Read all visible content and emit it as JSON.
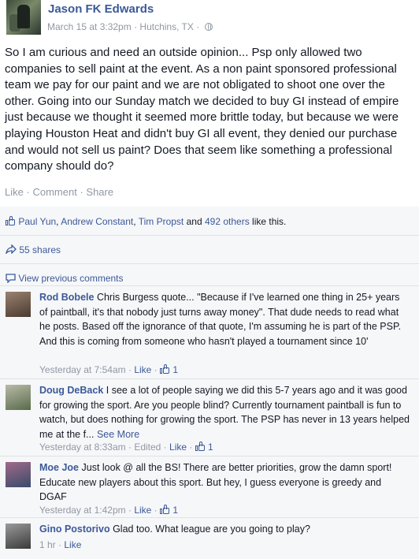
{
  "post": {
    "author": "Jason FK Edwards",
    "date": "March 15 at 3:32pm",
    "location": "Hutchins, TX",
    "separator": "·",
    "body": "So I am curious and need an outside opinion... Psp only allowed two companies to sell paint at the event. As a non paint sponsored professional team we pay for our paint and we are not obligated to shoot one over the other. Going into our Sunday match we decided to buy GI instead of empire just because we thought it seemed more brittle today, but because we were playing Houston Heat and didn't buy GI all event, they denied our purchase and would not sell us paint? Does that seem like something a professional company should do?",
    "actions": {
      "like": "Like",
      "comment": "Comment",
      "share": "Share"
    }
  },
  "likes_summary": {
    "names": [
      "Paul Yun",
      "Andrew Constant",
      "Tim Propst"
    ],
    "and": "and",
    "others": "492 others",
    "suffix": "like this."
  },
  "shares": "55 shares",
  "view_previous": "View previous comments",
  "comments": [
    {
      "name": "Rod Bobele",
      "text": "Chris Burgess quote... \"Because if I've learned one thing in 25+ years of paintball, it's that nobody just turns away money\". That dude needs to read what he posts. Based off the ignorance of that quote, I'm assuming he is part of the PSP. And this is coming from someone who hasn't played a tournament since 10'",
      "time": "Yesterday at 7:54am",
      "like": "Like",
      "likes": "1",
      "avatar_color": "#6b5a4a"
    },
    {
      "name": "Doug DeBack",
      "text": "I see a lot of people saying we did this 5-7 years ago and it was good for growing the sport. Are you people blind? Currently tournament paintball is fun to watch, but does nothing for growing the sport. The PSP has never in 13 years helped me at the f...",
      "see_more": "See More",
      "time": "Yesterday at 8:33am",
      "edited": "Edited",
      "like": "Like",
      "likes": "1",
      "avatar_color": "#8a8f7a"
    },
    {
      "name": "Moe Joe",
      "text": "Just look @ all the BS! There are better priorities, grow the damn sport! Educate new players about this sport. But hey, I guess everyone is greedy and DGAF",
      "time": "Yesterday at 1:42pm",
      "like": "Like",
      "likes": "1",
      "avatar_color": "#7a4a6a"
    },
    {
      "name": "Gino Postorivo",
      "text": "Glad too. What league are you going to play?",
      "time": "1 hr",
      "like": "Like",
      "avatar_color": "#5a5a5a"
    }
  ],
  "colors": {
    "link": "#3b5998",
    "meta": "#9197a3",
    "ufi_bg": "#f6f7f9",
    "text": "#141823"
  },
  "icons": [
    "globe-icon",
    "like-icon",
    "share-icon",
    "comment-icon"
  ]
}
